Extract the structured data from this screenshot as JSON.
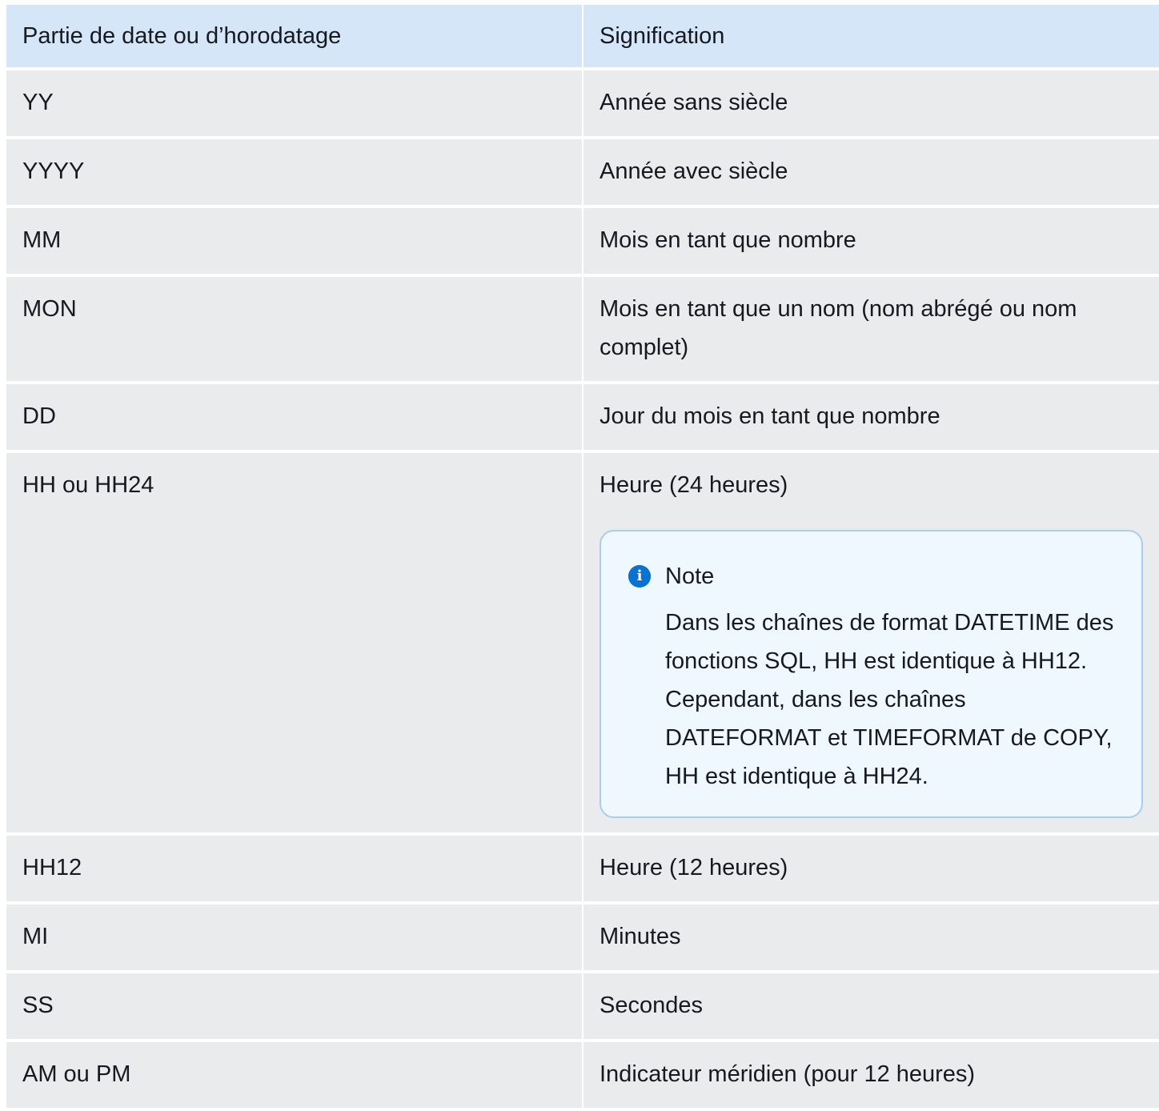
{
  "table": {
    "headers": [
      "Partie de date ou d’horodatage",
      "Signification"
    ],
    "rows": [
      {
        "part": "YY",
        "meaning": "Année sans siècle"
      },
      {
        "part": "YYYY",
        "meaning": "Année avec siècle"
      },
      {
        "part": "MM",
        "meaning": "Mois en tant que nombre"
      },
      {
        "part": "MON",
        "meaning": "Mois en tant que un nom (nom abrégé ou nom complet)"
      },
      {
        "part": "DD",
        "meaning": "Jour du mois en tant que nombre"
      },
      {
        "part": "HH ou HH24",
        "meaning": "Heure (24 heures)",
        "note": {
          "icon": "info-icon",
          "title": "Note",
          "text": "Dans les chaînes de format DATETIME des fonctions SQL, HH est identique à HH12. Cependant, dans les chaînes DATEFORMAT et TIMEFORMAT de COPY, HH est identique à HH24."
        }
      },
      {
        "part": "HH12",
        "meaning": "Heure (12 heures)"
      },
      {
        "part": "MI",
        "meaning": "Minutes"
      },
      {
        "part": "SS",
        "meaning": "Secondes"
      },
      {
        "part": "AM ou PM",
        "meaning": "Indicateur méridien (pour 12 heures)"
      }
    ]
  },
  "colors": {
    "header_bg": "#d5e6f8",
    "row_bg": "#e9ebed",
    "note_bg": "#f0f8ff",
    "note_border": "#a8cdef",
    "accent": "#0972d3"
  }
}
